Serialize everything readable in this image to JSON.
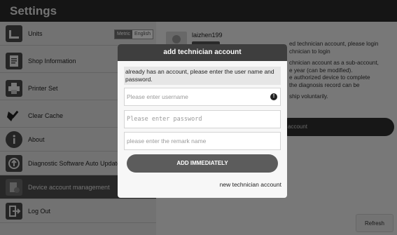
{
  "app": {
    "title": "Settings"
  },
  "sidebar": {
    "items": [
      {
        "label": "Units",
        "icon": "ruler-icon"
      },
      {
        "label": "Shop Information",
        "icon": "document-icon"
      },
      {
        "label": "Printer Set",
        "icon": "printer-icon"
      },
      {
        "label": "Clear Cache",
        "icon": "broom-icon"
      },
      {
        "label": "About",
        "icon": "info-icon"
      },
      {
        "label": "Diagnostic Software Auto Update",
        "icon": "update-icon"
      },
      {
        "label": "Device account management",
        "icon": "device-account-icon"
      },
      {
        "label": "Log Out",
        "icon": "logout-icon"
      }
    ],
    "units_toggle": {
      "metric": "Metric",
      "english": "English",
      "selected": "English"
    }
  },
  "main": {
    "username": "laizhen199",
    "info_lines": [
      "ed technician account, please login",
      "chnician to login",
      "chnician account as a sub-account,",
      "e year (can be modified).",
      "e authorized device to complete",
      "the diagnosis record can be",
      "ship voluntarily."
    ],
    "add_account_label": "account",
    "refresh_label": "Refresh"
  },
  "dialog": {
    "title": "add technician account",
    "message": "already has an account, please enter the user name and password.",
    "username_placeholder": "Please enter username",
    "password_placeholder": "Please enter password",
    "remark_placeholder": "please enter the remark name",
    "warning_glyph": "!",
    "submit_label": "ADD IMMEDIATELY",
    "new_account_link": "new technician account"
  }
}
